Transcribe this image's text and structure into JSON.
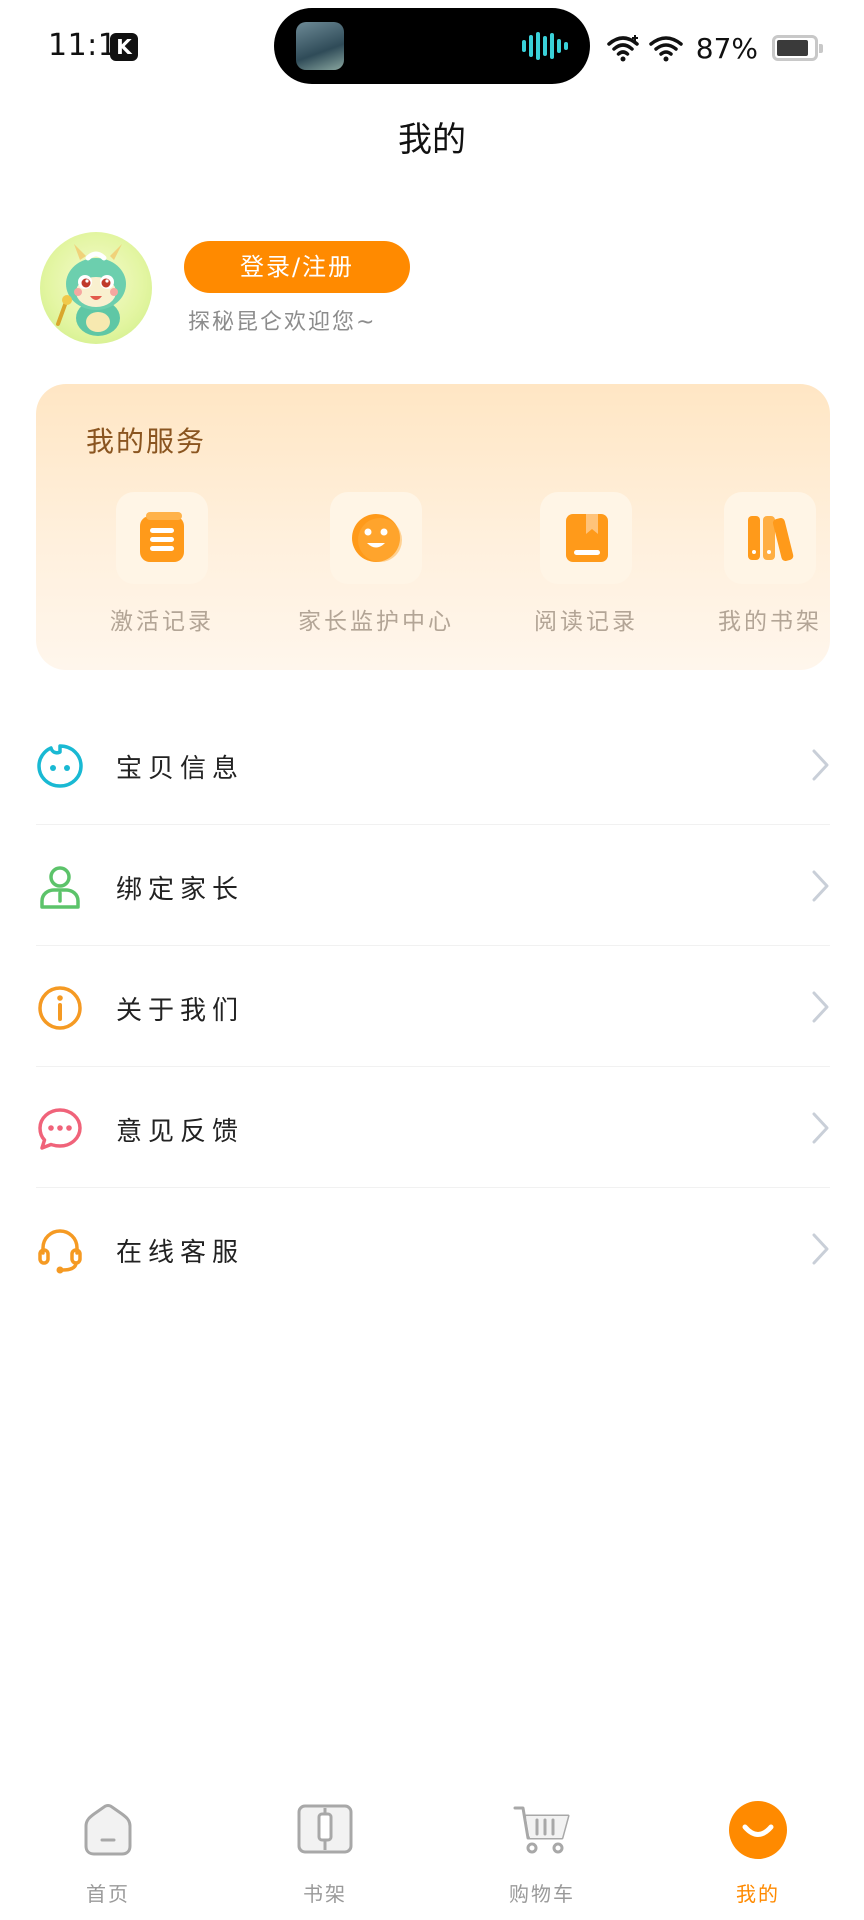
{
  "status_bar": {
    "time": "11:14",
    "app_badge": "K",
    "battery": "87%",
    "battery_level": 0.87
  },
  "header": {
    "title": "我的"
  },
  "profile": {
    "login_label": "登录/注册",
    "welcome": "探秘昆仑欢迎您~"
  },
  "services": {
    "title": "我的服务",
    "items": [
      {
        "label": "激活记录",
        "icon": "list-icon"
      },
      {
        "label": "家长监护中心",
        "icon": "smiley-icon"
      },
      {
        "label": "阅读记录",
        "icon": "book-icon"
      },
      {
        "label": "我的书架",
        "icon": "bookshelf-icon"
      }
    ]
  },
  "menu": {
    "items": [
      {
        "label": "宝贝信息",
        "icon": "baby-face-icon",
        "color": "#19b9d3"
      },
      {
        "label": "绑定家长",
        "icon": "parent-icon",
        "color": "#5cc36a"
      },
      {
        "label": "关于我们",
        "icon": "info-icon",
        "color": "#f59a23"
      },
      {
        "label": "意见反馈",
        "icon": "feedback-icon",
        "color": "#f0637a"
      },
      {
        "label": "在线客服",
        "icon": "headset-icon",
        "color": "#f59a23"
      }
    ]
  },
  "bottom_nav": {
    "items": [
      {
        "label": "首页",
        "icon": "home-icon"
      },
      {
        "label": "书架",
        "icon": "bookshelf-icon"
      },
      {
        "label": "购物车",
        "icon": "cart-icon"
      },
      {
        "label": "我的",
        "icon": "profile-smile-icon",
        "active": true
      }
    ]
  },
  "colors": {
    "accent": "#ff8a00",
    "service_icon": "#ff9a1a",
    "card_bg": "#ffe6c4",
    "inactive": "#9a9a9a"
  }
}
